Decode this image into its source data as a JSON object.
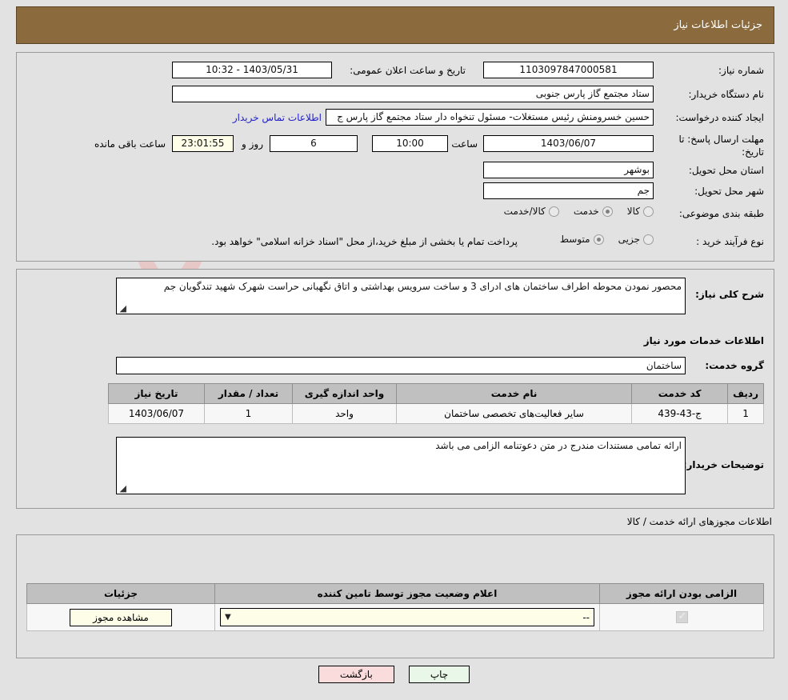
{
  "header": {
    "title": "جزئیات اطلاعات نیاز"
  },
  "main": {
    "need_number_label": "شماره نیاز:",
    "need_number_value": "1103097847000581",
    "announce_label": "تاریخ و ساعت اعلان عمومی:",
    "announce_value": "1403/05/31 - 10:32",
    "buyer_org_label": "نام دستگاه خریدار:",
    "buyer_org_value": "ستاد مجتمع گاز پارس جنوبی",
    "creator_label": "ایجاد کننده درخواست:",
    "creator_value": "حسین خسرومنش رئیس مستغلات- مسئول تنخواه دار  ستاد مجتمع گاز پارس ج",
    "contact_link": "اطلاعات تماس خریدار",
    "deadline_label": "مهلت ارسال پاسخ: تا تاریخ:",
    "deadline_date": "1403/06/07",
    "deadline_hour_label": "ساعت",
    "deadline_hour": "10:00",
    "days_value": "6",
    "days_label": "روز و",
    "countdown_value": "23:01:55",
    "countdown_label": "ساعت باقی مانده",
    "province_label": "استان محل تحویل:",
    "province_value": "بوشهر",
    "city_label": "شهر محل تحویل:",
    "city_value": "جم",
    "category_label": "طبقه بندی موضوعی:",
    "category_options": [
      {
        "label": "کالا",
        "selected": false
      },
      {
        "label": "خدمت",
        "selected": true
      },
      {
        "label": "کالا/خدمت",
        "selected": false
      }
    ],
    "process_label": "نوع فرآیند خرید :",
    "process_options": [
      {
        "label": "جزیی",
        "selected": false
      },
      {
        "label": "متوسط",
        "selected": true
      }
    ],
    "process_note": "پرداخت تمام یا بخشی از مبلغ خرید،از محل \"اسناد خزانه اسلامی\" خواهد بود."
  },
  "desc": {
    "summary_label": "شرح کلی نیاز:",
    "summary_value": "محصور نمودن محوطه اطراف ساختمان های ادرای 3 و ساخت سرویس بهداشتی و اتاق نگهبانی حراست شهرک شهید تندگویان جم",
    "services_caption": "اطلاعات خدمات مورد نیاز",
    "service_group_label": "گروه خدمت:",
    "service_group_value": "ساختمان",
    "table": {
      "columns": [
        "ردیف",
        "کد خدمت",
        "نام خدمت",
        "واحد اندازه گیری",
        "تعداد / مقدار",
        "تاریخ نیاز"
      ],
      "rows": [
        [
          "1",
          "ج-43-439",
          "سایر فعالیت‌های تخصصی ساختمان",
          "واحد",
          "1",
          "1403/06/07"
        ]
      ]
    },
    "notes_label": "توضیحات خریدار:",
    "notes_value": "ارائه تمامی مستندات مندرج در متن دعوتنامه الزامی می باشد"
  },
  "permits": {
    "caption": "اطلاعات مجوزهای ارائه خدمت / کالا",
    "columns": [
      "الزامی بودن ارائه مجوز",
      "اعلام وضعیت مجوز توسط تامین کننده",
      "جزئیات"
    ],
    "row": {
      "required_checked": true,
      "status_value": "--",
      "details_button": "مشاهده مجوز"
    }
  },
  "footer": {
    "print_label": "چاپ",
    "back_label": "بازگشت"
  },
  "watermark": {
    "text": "AriaTender.net"
  },
  "colors": {
    "header_bg": "#8b6b3d",
    "page_bg": "#e2e2e2",
    "link": "#2222cc",
    "print_btn": "#e9f7e9",
    "back_btn": "#fbdcdc",
    "cream_field": "#fdfde8"
  }
}
